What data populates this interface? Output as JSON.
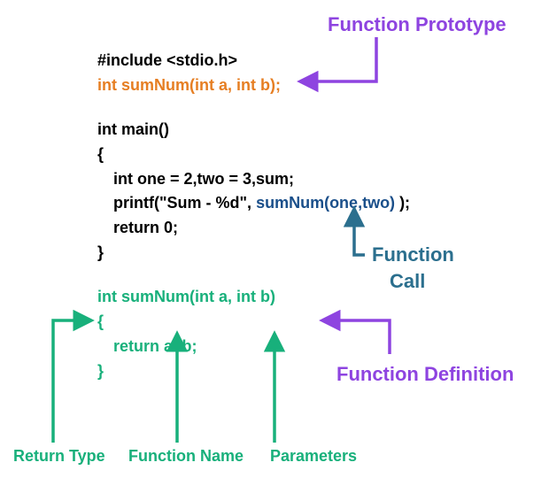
{
  "code": {
    "include": "#include <stdio.h>",
    "prototype": "int sumNum(int a, int b);",
    "main_sig": "int main()",
    "brace_open": "{",
    "decl_indent": "   ",
    "decl": "int one = 2,two = 3,sum;",
    "printf_prefix": "printf(\"Sum - %d\", ",
    "call": "sumNum(one,two)",
    "printf_suffix": " );",
    "return0": "return 0;",
    "brace_close": "}",
    "def_sig": "int sumNum(int a, int b)",
    "def_open": "{",
    "def_body": "return a+b;",
    "def_close": "}"
  },
  "labels": {
    "prototype": "Function Prototype",
    "call_line1": "Function",
    "call_line2": "Call",
    "definition": "Function Definition",
    "return_type": "Return Type",
    "func_name": "Function Name",
    "parameters": "Parameters"
  }
}
